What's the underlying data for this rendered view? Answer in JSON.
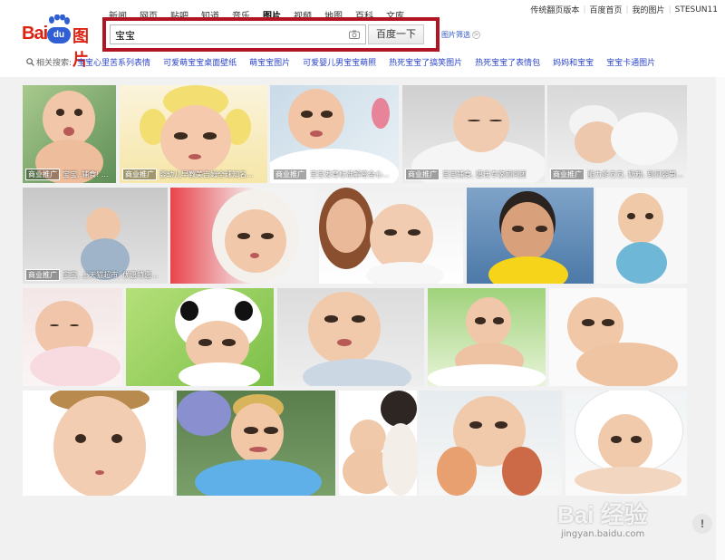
{
  "top_links": [
    "传统翻页版本",
    "百度首页",
    "我的图片",
    "STESUN11"
  ],
  "nav_tabs": [
    {
      "label": "新闻",
      "active": false
    },
    {
      "label": "网页",
      "active": false
    },
    {
      "label": "贴吧",
      "active": false
    },
    {
      "label": "知道",
      "active": false
    },
    {
      "label": "音乐",
      "active": false
    },
    {
      "label": "图片",
      "active": true
    },
    {
      "label": "视频",
      "active": false
    },
    {
      "label": "地图",
      "active": false
    },
    {
      "label": "百科",
      "active": false
    },
    {
      "label": "文库",
      "active": false
    }
  ],
  "logo": {
    "bai": "Bai",
    "du": "du",
    "tu": "图片"
  },
  "search": {
    "value": "宝宝",
    "button": "百度一下",
    "filter": "图片筛选",
    "filter_icon": ">"
  },
  "related": {
    "label": "相关搜索:",
    "items": [
      "宝宝心里苦系列表情",
      "可爱萌宝宝桌面壁纸",
      "萌宝宝图片",
      "可爱婴儿男宝宝萌照",
      "热死宝宝了搞笑图片",
      "热死宝宝了表情包",
      "妈妈和宝宝",
      "宝宝卡通图片"
    ]
  },
  "tiles": [
    {
      "ad": "商业推广",
      "caption": "宝宝, 辅食! ..."
    },
    {
      "ad": "商业推广",
      "caption": "婴幼儿早教美吉姆全球知名..."
    },
    {
      "ad": "商业推广",
      "caption": "宝宝发育标准解密全心..."
    },
    {
      "ad": "商业推广",
      "caption": "宝宝辅食, 惠氏专家顾问团"
    },
    {
      "ad": "商业推广",
      "caption": "能力多方方, 奶粉, 到贝婴第4..."
    },
    {
      "ad": "商业推广",
      "caption": "宝宝, 上天猫超市, 优惠特惠..."
    },
    {
      "ad": "",
      "caption": ""
    },
    {
      "ad": "",
      "caption": ""
    },
    {
      "ad": "",
      "caption": ""
    },
    {
      "ad": "",
      "caption": ""
    },
    {
      "ad": "",
      "caption": ""
    },
    {
      "ad": "",
      "caption": ""
    },
    {
      "ad": "",
      "caption": ""
    },
    {
      "ad": "",
      "caption": ""
    },
    {
      "ad": "",
      "caption": ""
    },
    {
      "ad": "",
      "caption": ""
    },
    {
      "ad": "",
      "caption": ""
    },
    {
      "ad": "",
      "caption": ""
    },
    {
      "ad": "",
      "caption": ""
    },
    {
      "ad": "",
      "caption": ""
    },
    {
      "ad": "",
      "caption": ""
    }
  ],
  "watermark": {
    "logo": "Bai 经验",
    "url": "jingyan.baidu.com"
  },
  "feedback": "!",
  "colors": {
    "accent_red": "#b11423",
    "link_blue": "#2d46c9",
    "logo_blue": "#2f5fd3",
    "logo_red": "#de2110"
  }
}
